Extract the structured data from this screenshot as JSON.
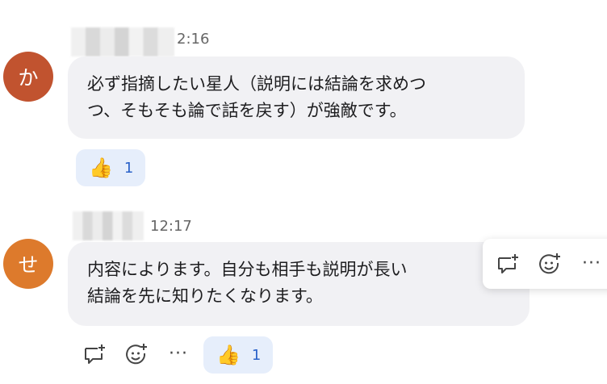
{
  "messages": [
    {
      "avatar_initial": "か",
      "avatar_color": "#c1532f",
      "time": "2:16",
      "lines": [
        "必ず指摘したい星人（説明には結論を求めつ",
        "つ、そもそも論で話を戻す）が強敵です。"
      ],
      "reaction": {
        "emoji": "👍",
        "count": "1"
      }
    },
    {
      "avatar_initial": "せ",
      "avatar_color": "#dd7a2c",
      "time": "12:17",
      "lines": [
        "内容によります。自分も相手も説明が長い",
        "結論を先に知りたくなります。"
      ],
      "reaction": {
        "emoji": "👍",
        "count": "1"
      }
    }
  ],
  "actions": {
    "reply_icon": "comment-plus-icon",
    "emoji_icon": "add-reaction-icon",
    "more_label": "···"
  }
}
